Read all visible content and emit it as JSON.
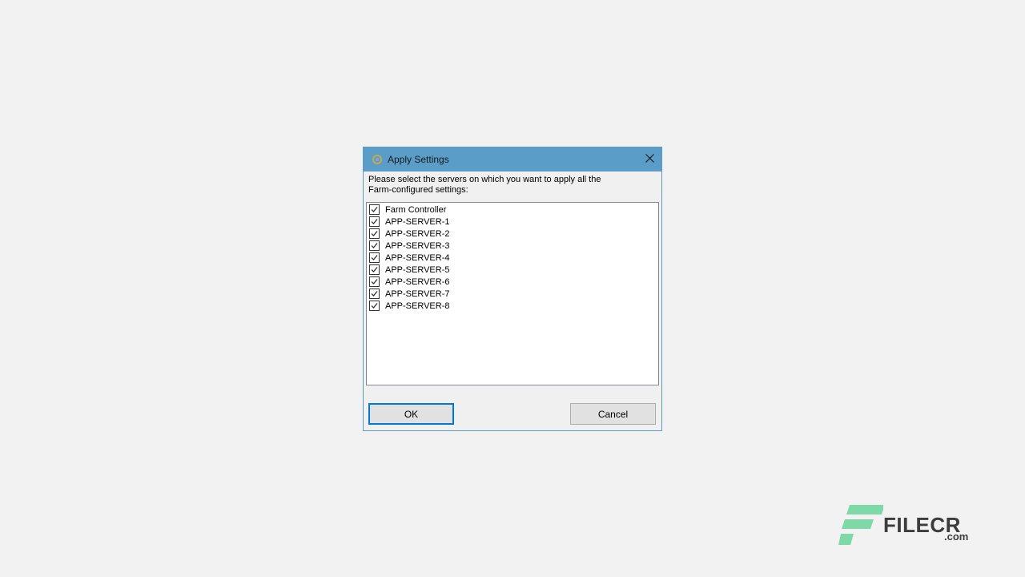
{
  "dialog": {
    "title": "Apply Settings",
    "title_icon": "app-gear-icon",
    "close_icon": "close-icon",
    "instructions": "Please select the servers on which you want to apply all the Farm-configured settings:",
    "servers": [
      {
        "label": "Farm Controller",
        "checked": true
      },
      {
        "label": "APP-SERVER-1",
        "checked": true
      },
      {
        "label": "APP-SERVER-2",
        "checked": true
      },
      {
        "label": "APP-SERVER-3",
        "checked": true
      },
      {
        "label": "APP-SERVER-4",
        "checked": true
      },
      {
        "label": "APP-SERVER-5",
        "checked": true
      },
      {
        "label": "APP-SERVER-6",
        "checked": true
      },
      {
        "label": "APP-SERVER-7",
        "checked": true
      },
      {
        "label": "APP-SERVER-8",
        "checked": true
      }
    ],
    "ok_label": "OK",
    "cancel_label": "Cancel"
  },
  "watermark": {
    "brand": "FILECR",
    "suffix": ".com",
    "color": "#7fd8a8"
  },
  "colors": {
    "titlebar": "#5a9dc8",
    "focus_border": "#0078d7"
  }
}
